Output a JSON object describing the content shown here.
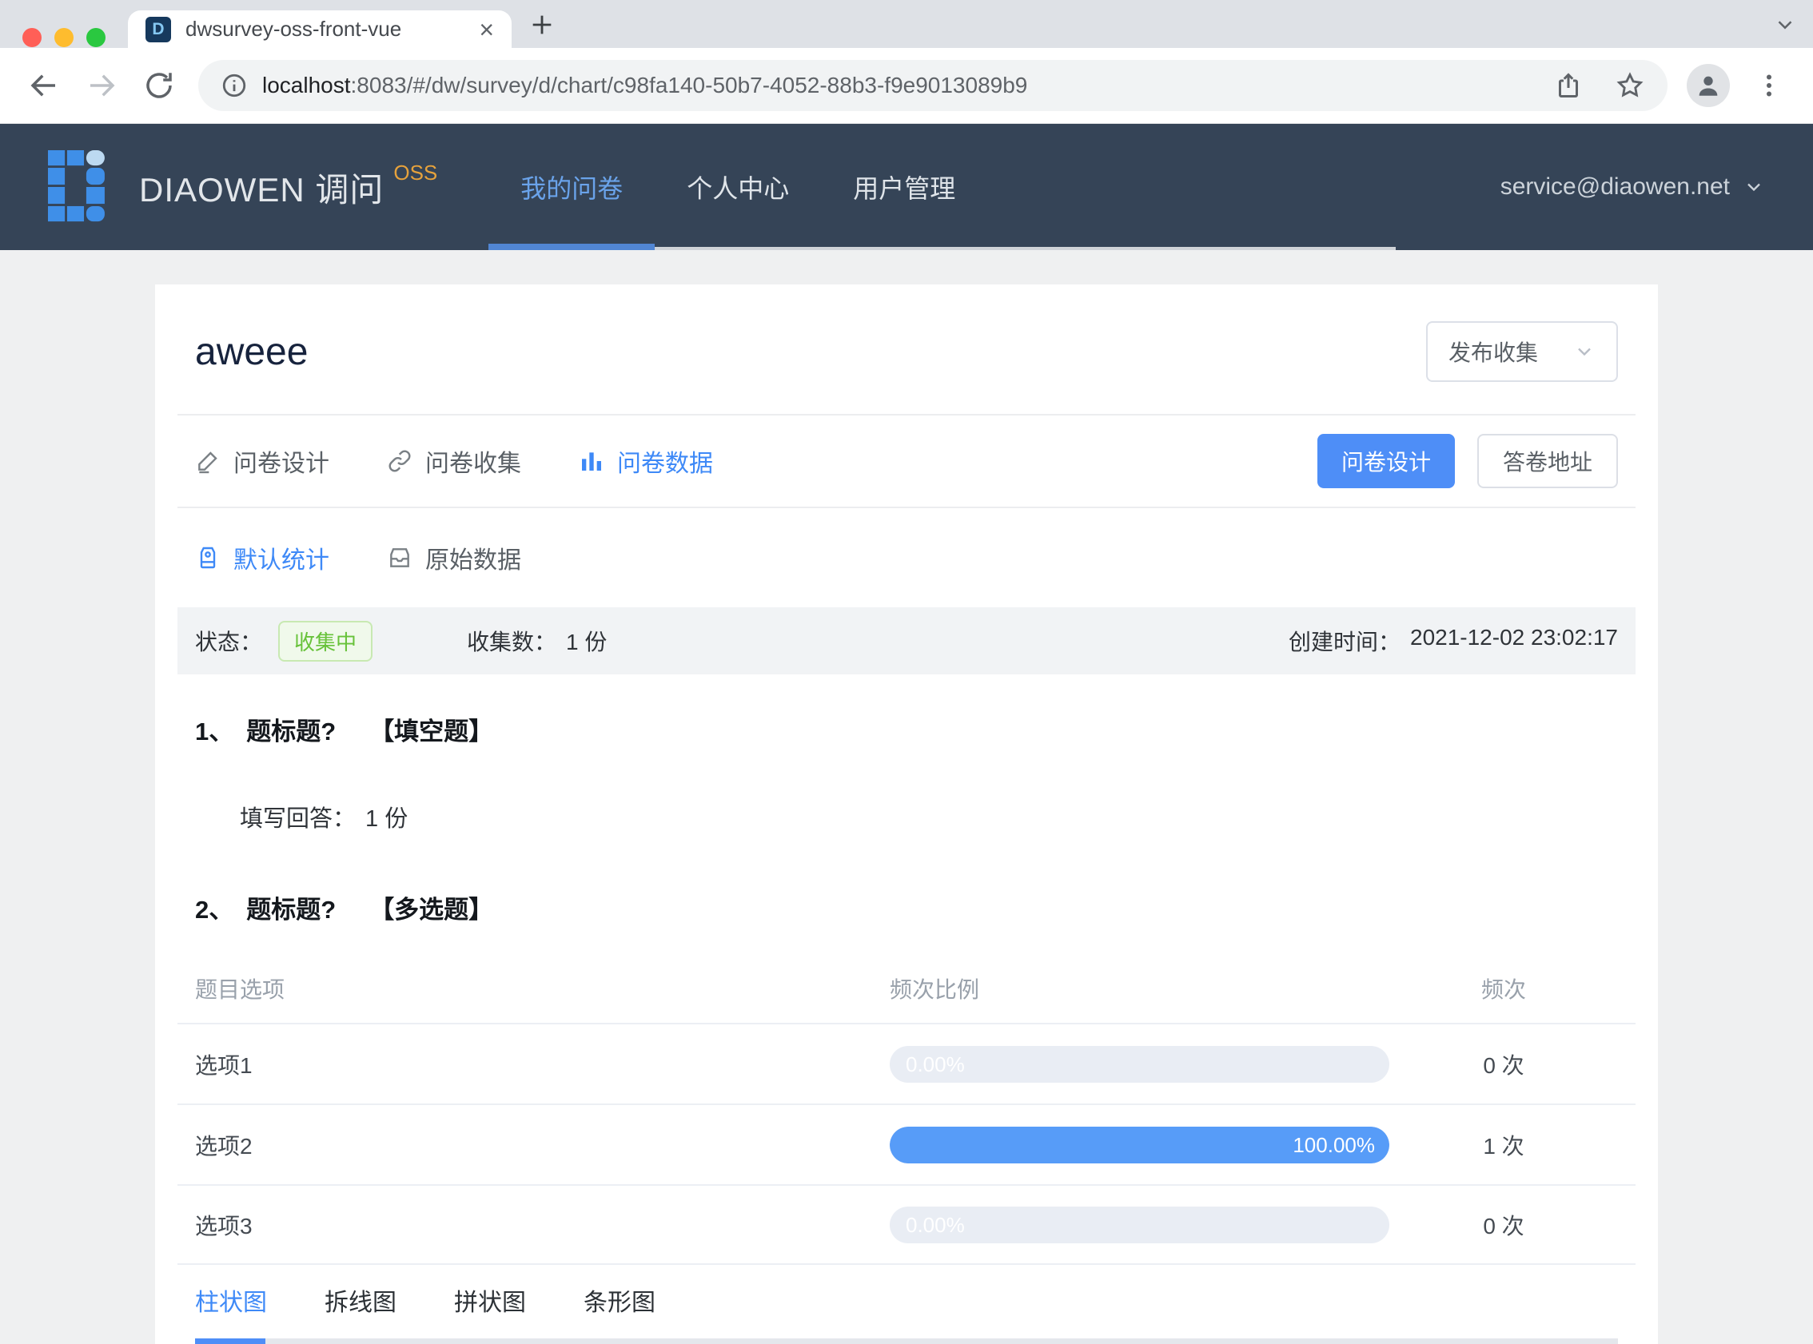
{
  "browser": {
    "tab_title": "dwsurvey-oss-front-vue",
    "close_glyph": "×",
    "url": {
      "host": "localhost",
      "rest": ":8083/#/dw/survey/d/chart/c98fa140-50b7-4052-88b3-f9e9013089b9"
    }
  },
  "appbar": {
    "brand": "DIAOWEN 调问",
    "badge": "OSS",
    "nav": [
      {
        "label": "我的问卷",
        "active": true
      },
      {
        "label": "个人中心",
        "active": false
      },
      {
        "label": "用户管理",
        "active": false
      }
    ],
    "account": "service@diaowen.net"
  },
  "page": {
    "title": "aweee",
    "publish_select": "发布收集",
    "tabs": {
      "design": "问卷设计",
      "collect": "问卷收集",
      "data": "问卷数据"
    },
    "buttons": {
      "design": "问卷设计",
      "answer_url": "答卷地址"
    },
    "subtabs": {
      "stats": "默认统计",
      "raw": "原始数据"
    },
    "status": {
      "state_label": "状态：",
      "state": "收集中",
      "count_label": "收集数：",
      "count": "1 份",
      "created_label": "创建时间：",
      "created": "2021-12-02 23:02:17"
    }
  },
  "q1": {
    "index": "1、",
    "title": "题标题?",
    "type": "【填空题】",
    "answer_label": "填写回答：",
    "answer_value": "1 份"
  },
  "q2": {
    "index": "2、",
    "title": "题标题?",
    "type": "【多选题】",
    "headers": {
      "option": "题目选项",
      "ratio": "频次比例",
      "freq": "频次"
    },
    "rows": [
      {
        "option": "选项1",
        "percent": 0,
        "percent_label": "0.00%",
        "freq": "0 次"
      },
      {
        "option": "选项2",
        "percent": 100,
        "percent_label": "100.00%",
        "freq": "1 次"
      },
      {
        "option": "选项3",
        "percent": 0,
        "percent_label": "0.00%",
        "freq": "0 次"
      }
    ]
  },
  "chart_tabs": [
    {
      "label": "柱状图",
      "active": true
    },
    {
      "label": "拆线图",
      "active": false
    },
    {
      "label": "拼状图",
      "active": false
    },
    {
      "label": "条形图",
      "active": false
    }
  ],
  "colors": {
    "accent": "#4e8ef7",
    "bar_fill": "#579cf8",
    "bar_track": "#e9edf4",
    "success": "#67c23a",
    "header_bg": "#354457",
    "badge_orange": "#e6a23c"
  }
}
